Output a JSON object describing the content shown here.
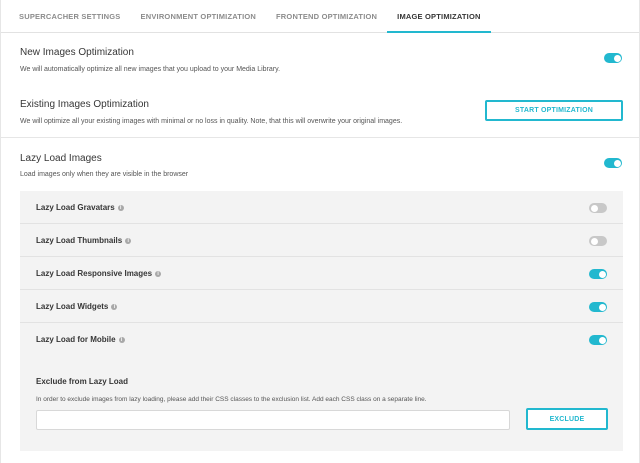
{
  "tabs": [
    {
      "label": "SUPERCACHER SETTINGS",
      "active": false
    },
    {
      "label": "ENVIRONMENT OPTIMIZATION",
      "active": false
    },
    {
      "label": "FRONTEND OPTIMIZATION",
      "active": false
    },
    {
      "label": "IMAGE OPTIMIZATION",
      "active": true
    }
  ],
  "new_images": {
    "title": "New Images Optimization",
    "description": "We will automatically optimize all new images that you upload to your Media Library.",
    "enabled": true
  },
  "existing_images": {
    "title": "Existing Images Optimization",
    "description": "We will optimize all your existing images with minimal or no loss in quality. Note, that this will overwrite your original images.",
    "button_label": "START OPTIMIZATION"
  },
  "lazy_load": {
    "title": "Lazy Load Images",
    "description": "Load images only when they are visible in the browser",
    "enabled": true,
    "options": [
      {
        "label": "Lazy Load Gravatars",
        "enabled": false
      },
      {
        "label": "Lazy Load Thumbnails",
        "enabled": false
      },
      {
        "label": "Lazy Load Responsive Images",
        "enabled": true
      },
      {
        "label": "Lazy Load Widgets",
        "enabled": true
      },
      {
        "label": "Lazy Load for Mobile",
        "enabled": true
      }
    ],
    "exclude": {
      "title": "Exclude from Lazy Load",
      "description": "In order to exclude images from lazy loading, please add their CSS classes to the exclusion list. Add each CSS class on a separate line.",
      "input_value": "",
      "button_label": "EXCLUDE"
    }
  },
  "colors": {
    "accent": "#22b8cf",
    "toggle_off": "#c8c8c8",
    "panel_bg": "#f3f3f3"
  },
  "icons": {
    "info": "info-circle-icon"
  }
}
